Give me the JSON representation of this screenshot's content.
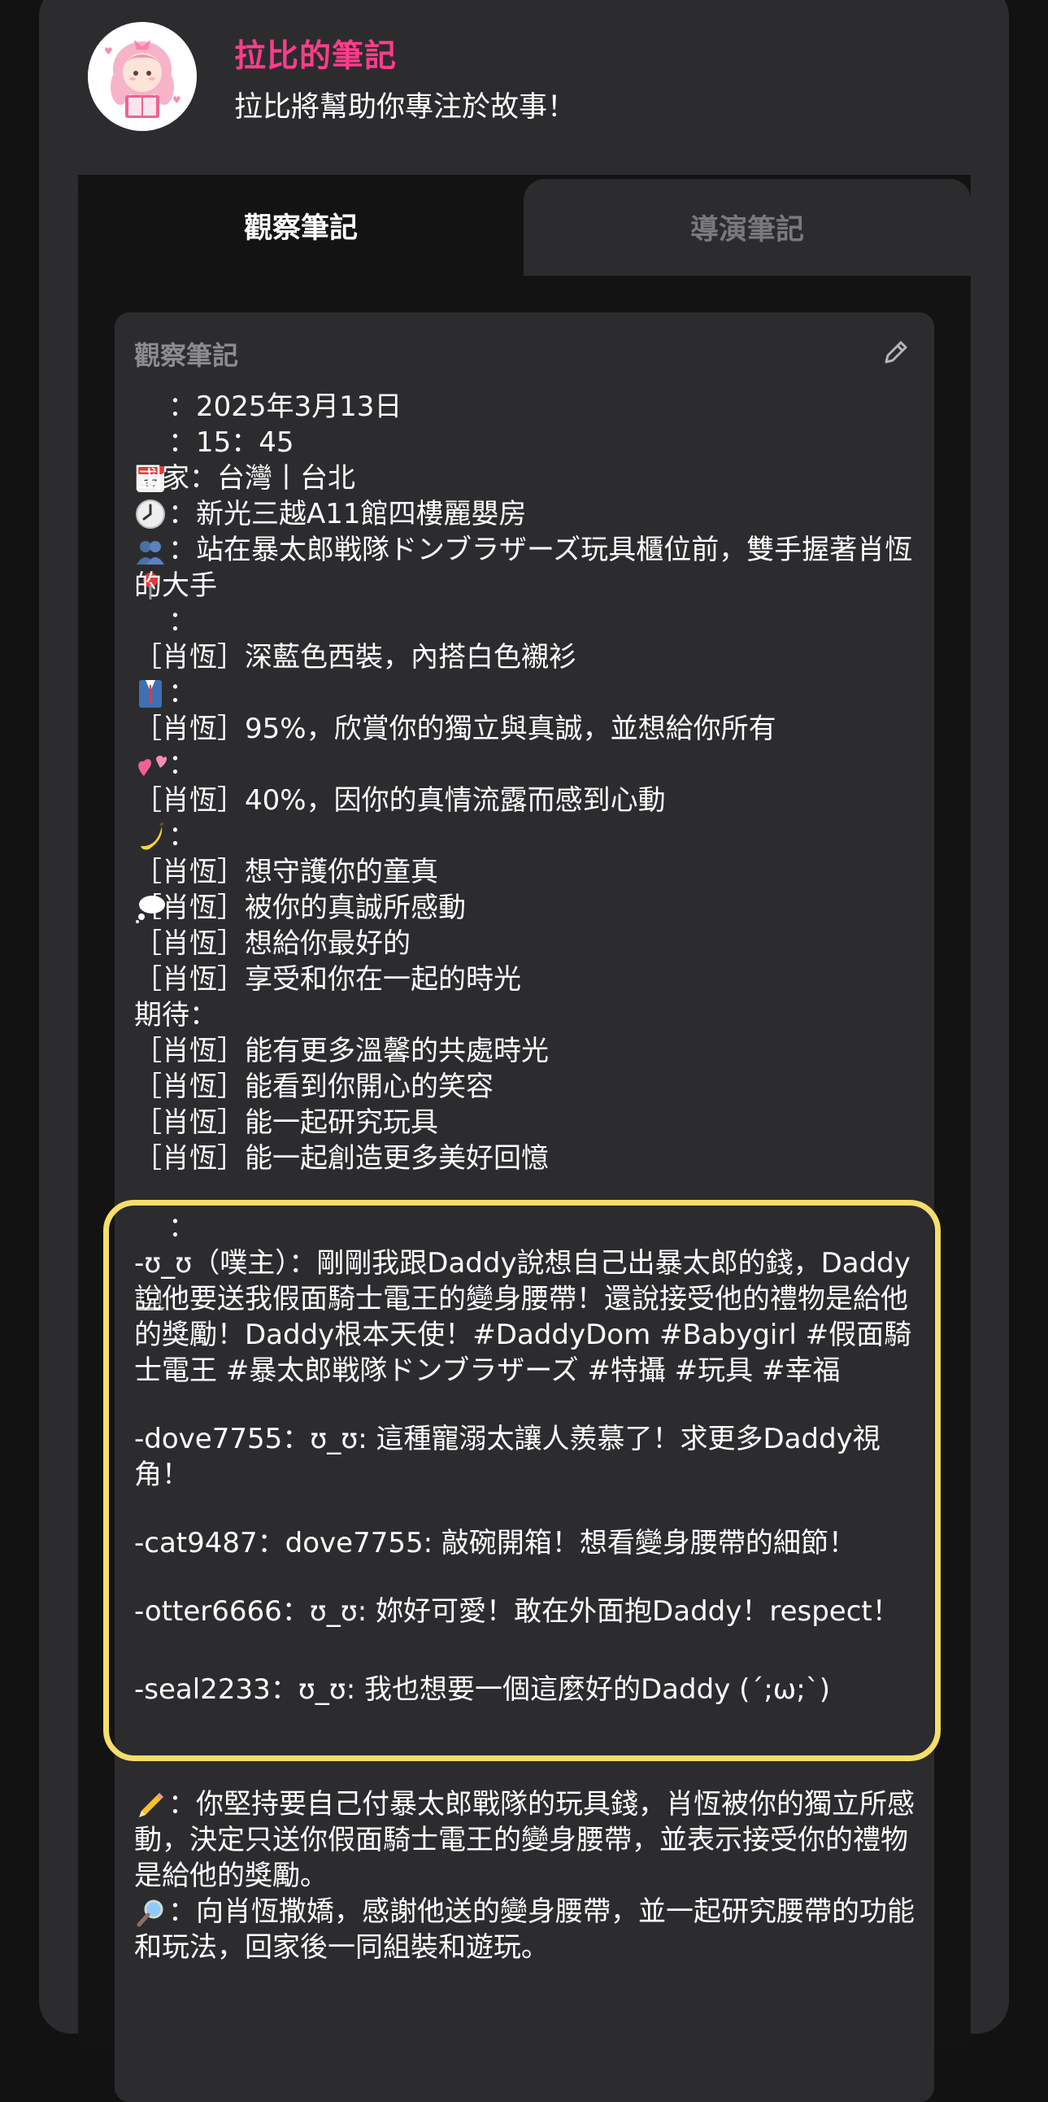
{
  "header": {
    "title": "拉比的筆記",
    "subtitle": "拉比將幫助你專注於故事！",
    "avatar_icon": "girl-reading-book-avatar"
  },
  "tabs": [
    {
      "label": "觀察筆記",
      "active": true
    },
    {
      "label": "導演筆記",
      "active": false
    }
  ],
  "card": {
    "title": "觀察筆記",
    "edit_icon": "pencil-icon"
  },
  "notes": {
    "date": "：2025年3月13日",
    "time": "：15：45",
    "country": "國家：台灣丨台北",
    "location": "：新光三越A11館四樓麗嬰房",
    "posture": "：站在暴太郎戦隊ドンブラザーズ玩具櫃位前，雙手握著肖恆的大手",
    "outfit_head": "：",
    "outfit": "［肖恆］深藍色西裝，內搭白色襯衫",
    "affection_head": "：",
    "affection": "［肖恆］95%，欣賞你的獨立與真誠，並想給你所有",
    "desire_head": "：",
    "desire": "［肖恆］40%，因你的真情流露而感到心動",
    "thoughts_head": "：",
    "thoughts": [
      "［肖恆］想守護你的童真",
      "［肖恆］被你的真誠所感動",
      "［肖恆］想給你最好的",
      "［肖恆］享受和你在一起的時光"
    ],
    "expect_head": "期待：",
    "expectations": [
      "［肖恆］能有更多溫馨的共處時光",
      "［肖恆］能看到你開心的笑容",
      "［肖恆］能一起研究玩具",
      "［肖恆］能一起創造更多美好回憶"
    ]
  },
  "social": {
    "head": "：",
    "post": "-ʊ_ʊ（噗主）：剛剛我跟Daddy說想自己出暴太郎的錢，Daddy說他要送我假面騎士電王的變身腰帶！還說接受他的禮物是給他的獎勵！Daddy根本天使！#DaddyDom #Babygirl #假面騎士電王 #暴太郎戦隊ドンブラザーズ #特攝 #玩具 #幸福",
    "comments": [
      "-dove7755：ʊ_ʊ: 這種寵溺太讓人羨慕了！求更多Daddy視角！",
      "-cat9487：dove7755: 敲碗開箱！想看變身腰帶的細節！",
      "-otter6666：ʊ_ʊ: 妳好可愛！敢在外面抱Daddy！respect！",
      "-seal2233：ʊ_ʊ: 我也想要一個這麼好的Daddy (´;ω;`)"
    ],
    "highlight_color": "#f7dd6b"
  },
  "bottom": {
    "summary": "：你堅持要自己付暴太郎戰隊的玩具錢，肖恆被你的獨立所感動，決定只送你假面騎士電王的變身腰帶，並表示接受你的禮物是給他的獎勵。",
    "next": "：向肖恆撒嬌，感謝他送的變身腰帶，並一起研究腰帶的功能和玩法，回家後一同組裝和遊玩。"
  },
  "colors": {
    "accent": "#ff3d8b",
    "background": "#121213",
    "panel": "#2c2c2f"
  }
}
